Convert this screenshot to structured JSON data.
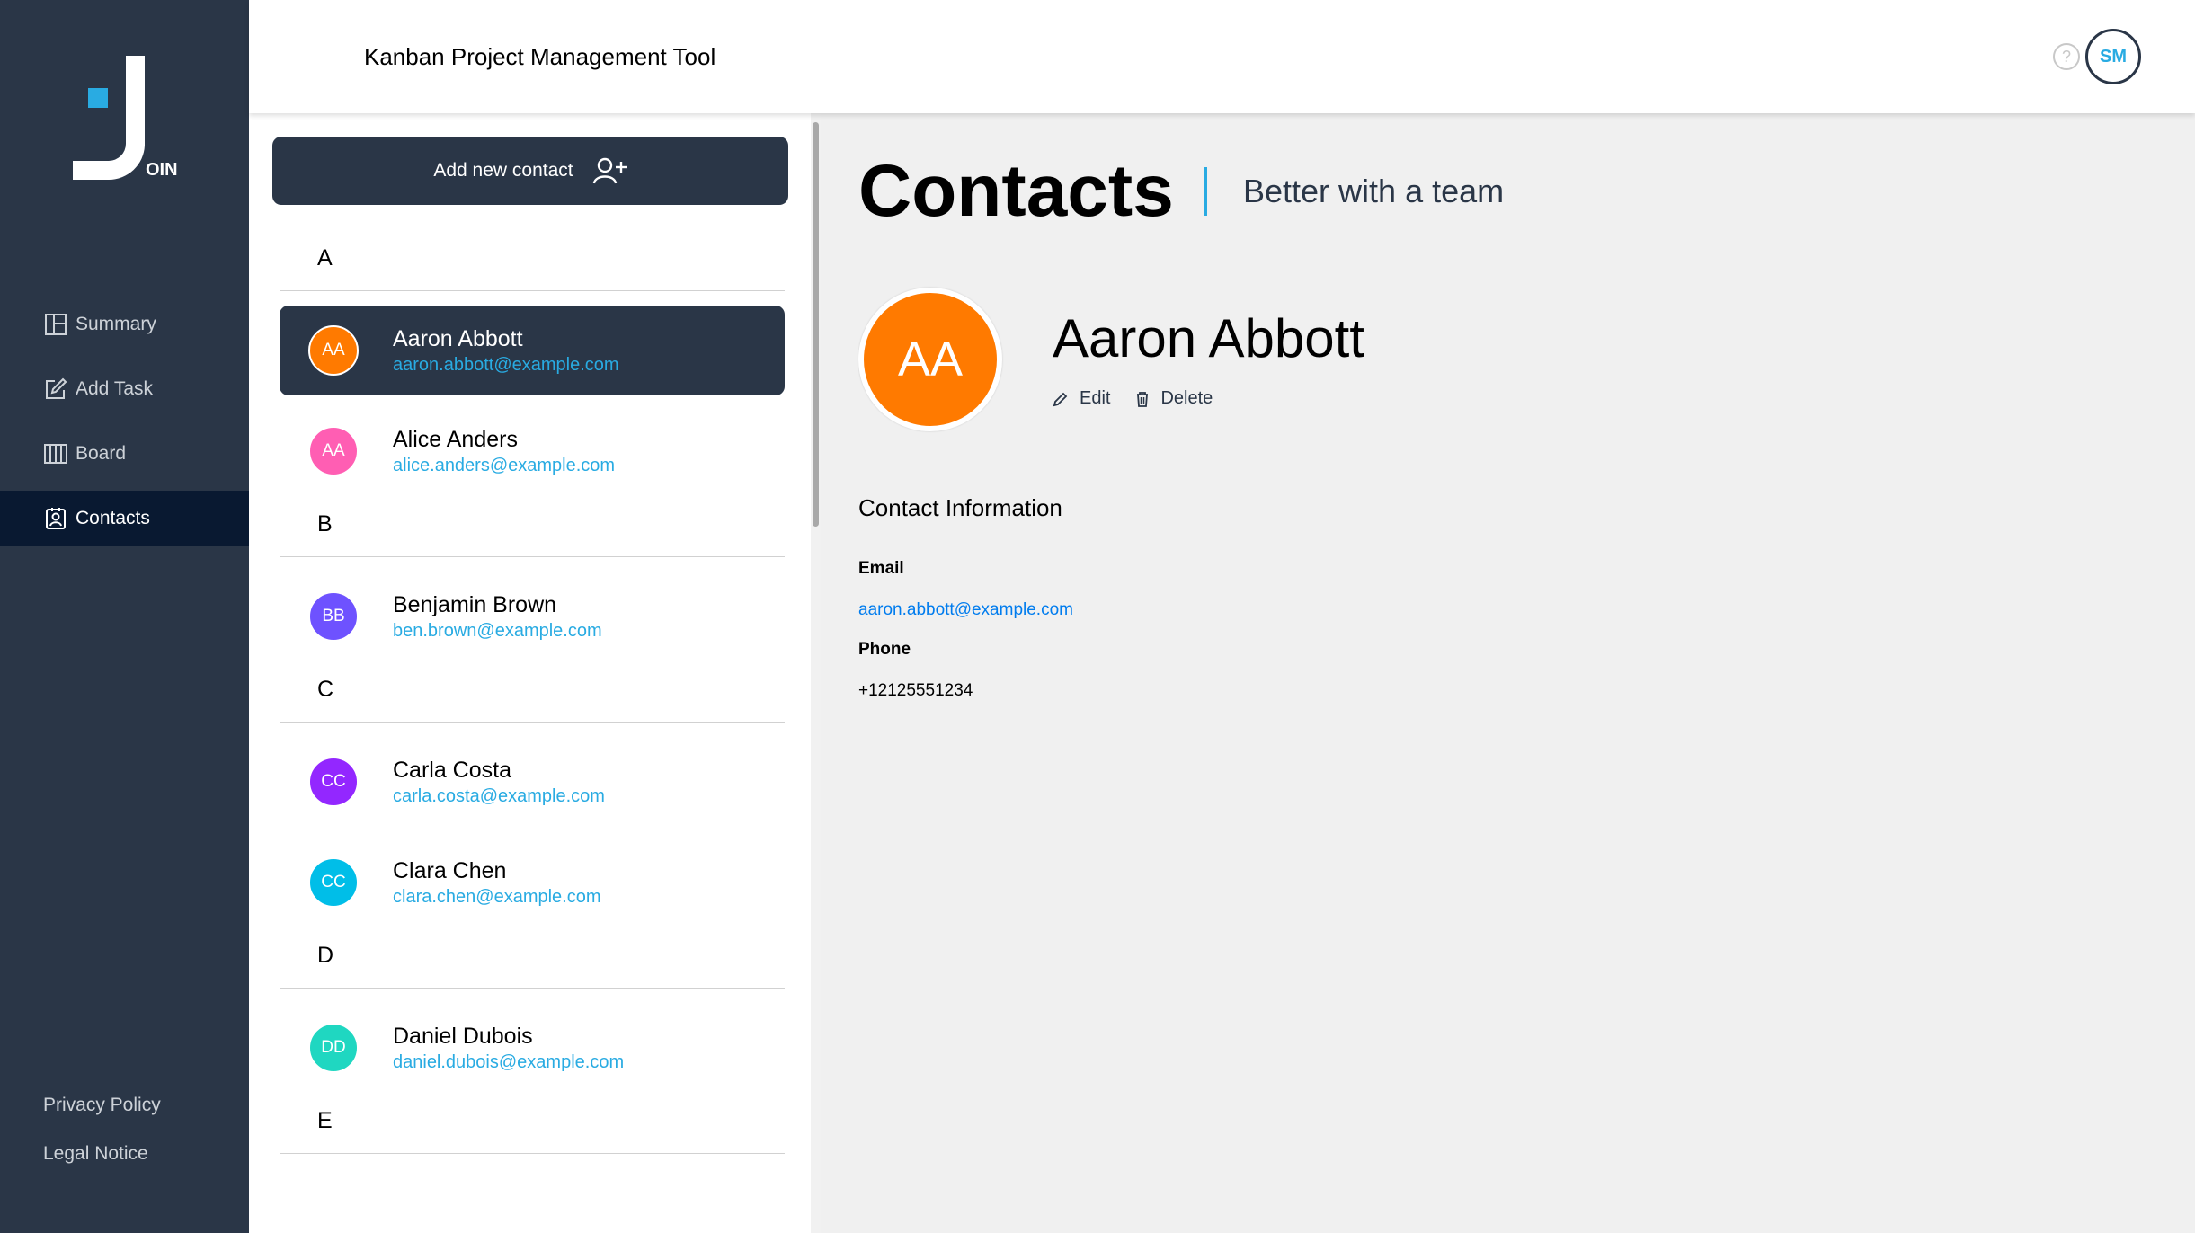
{
  "app": {
    "logo_letters": "OIN",
    "header_title": "Kanban Project Management Tool",
    "help_glyph": "?",
    "user_initials": "SM"
  },
  "sidebar": {
    "items": [
      {
        "label": "Summary",
        "icon": "summary-icon"
      },
      {
        "label": "Add Task",
        "icon": "edit-square-icon"
      },
      {
        "label": "Board",
        "icon": "board-icon"
      },
      {
        "label": "Contacts",
        "icon": "contacts-icon",
        "active": true
      }
    ],
    "footer": [
      "Privacy Policy",
      "Legal Notice"
    ]
  },
  "list": {
    "add_button_label": "Add new contact",
    "groups": [
      {
        "letter": "A",
        "contacts": [
          {
            "initials": "AA",
            "name": "Aaron Abbott",
            "email": "aaron.abbott@example.com",
            "color": "#ff7a00",
            "active": true
          },
          {
            "initials": "AA",
            "name": "Alice Anders",
            "email": "alice.anders@example.com",
            "color": "#ff5eb3"
          }
        ]
      },
      {
        "letter": "B",
        "contacts": [
          {
            "initials": "BB",
            "name": "Benjamin Brown",
            "email": "ben.brown@example.com",
            "color": "#6e52ff"
          }
        ]
      },
      {
        "letter": "C",
        "contacts": [
          {
            "initials": "CC",
            "name": "Carla Costa",
            "email": "carla.costa@example.com",
            "color": "#9327ff"
          },
          {
            "initials": "CC",
            "name": "Clara Chen",
            "email": "clara.chen@example.com",
            "color": "#00bee8"
          }
        ]
      },
      {
        "letter": "D",
        "contacts": [
          {
            "initials": "DD",
            "name": "Daniel Dubois",
            "email": "daniel.dubois@example.com",
            "color": "#1fd7c1"
          }
        ]
      },
      {
        "letter": "E",
        "contacts": []
      }
    ]
  },
  "detail": {
    "page_title": "Contacts",
    "subtitle": "Better with a team",
    "initials": "AA",
    "name": "Aaron Abbott",
    "edit_label": "Edit",
    "delete_label": "Delete",
    "info_heading": "Contact Information",
    "email_label": "Email",
    "email_value": "aaron.abbott@example.com",
    "phone_label": "Phone",
    "phone_value": "+12125551234"
  }
}
